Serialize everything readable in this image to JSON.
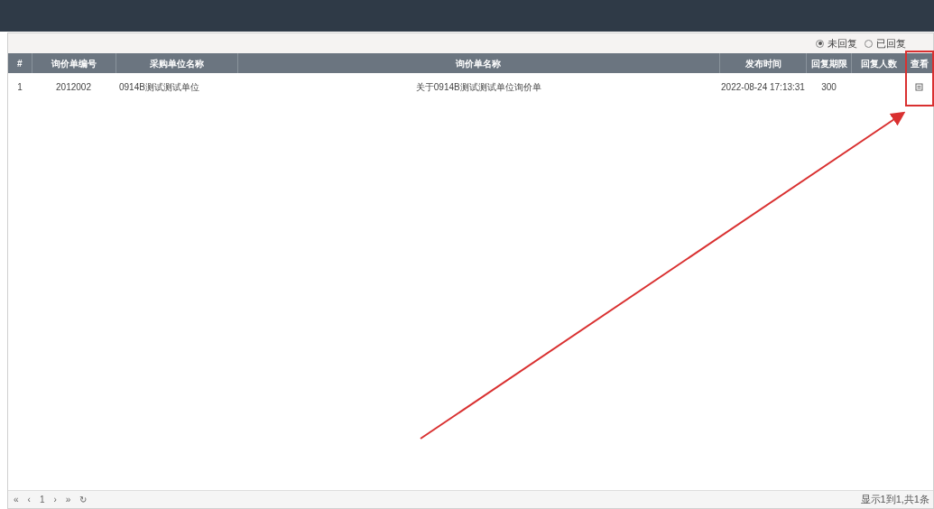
{
  "filter": {
    "options": [
      {
        "label": "未回复",
        "selected": true
      },
      {
        "label": "已回复",
        "selected": false
      }
    ]
  },
  "table": {
    "columns": [
      "#",
      "询价单编号",
      "采购单位名称",
      "询价单名称",
      "发布时间",
      "回复期限",
      "回复人数",
      "查看"
    ],
    "rows": [
      {
        "cells": [
          "1",
          "2012002",
          "0914B测试测试单位",
          "关于0914B测试测试单位询价单",
          "2022-08-24 17:13:31",
          "300"
        ],
        "viewable": true
      }
    ]
  },
  "pager": {
    "buttons": [
      "«",
      "‹",
      "1",
      "›",
      "»",
      "↻"
    ],
    "summary": "显示1到1,共1条"
  }
}
